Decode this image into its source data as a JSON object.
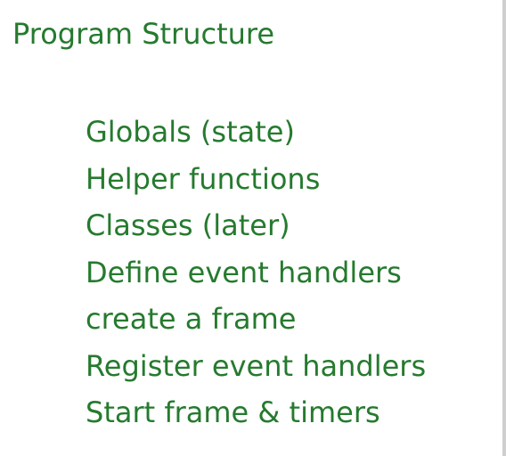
{
  "colors": {
    "text": "#257a2e",
    "background": "#ffffff"
  },
  "slide": {
    "title": "Program Structure",
    "items": [
      "Globals (state)",
      "Helper functions",
      "Classes (later)",
      "Define event handlers",
      "create a frame",
      "Register event handlers",
      "Start frame & timers"
    ]
  }
}
